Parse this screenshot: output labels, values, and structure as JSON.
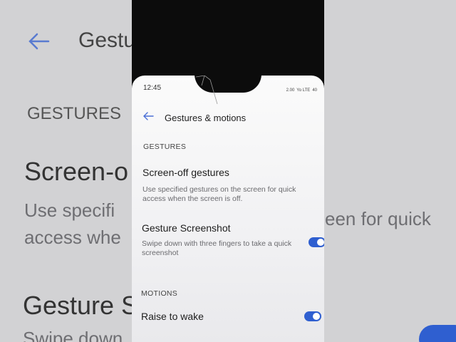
{
  "status": {
    "time": "12:45",
    "speed": "2.00",
    "network": "Yo LTE",
    "battery": "40"
  },
  "header": {
    "title": "Gestures & motions"
  },
  "sections": {
    "gestures": "GESTURES",
    "motions": "MOTIONS"
  },
  "items": [
    {
      "title": "Screen-off gestures",
      "description": "Use specified gestures on the screen for quick access when the screen is off."
    },
    {
      "title": "Gesture Screenshot",
      "description": "Swipe down with three fingers to take a quick screenshot",
      "enabled": true
    },
    {
      "title": "Raise to wake",
      "enabled": true
    }
  ],
  "background_text": {
    "title": "Gestu",
    "section": "GESTURES",
    "item1": "Screen-o",
    "desc1a": "Use specifi",
    "desc1b": "access whe",
    "desc1c": "een for quick",
    "item2": "Gesture S",
    "desc2": "Swipe down"
  },
  "colors": {
    "accent": "#2f5fd0"
  }
}
